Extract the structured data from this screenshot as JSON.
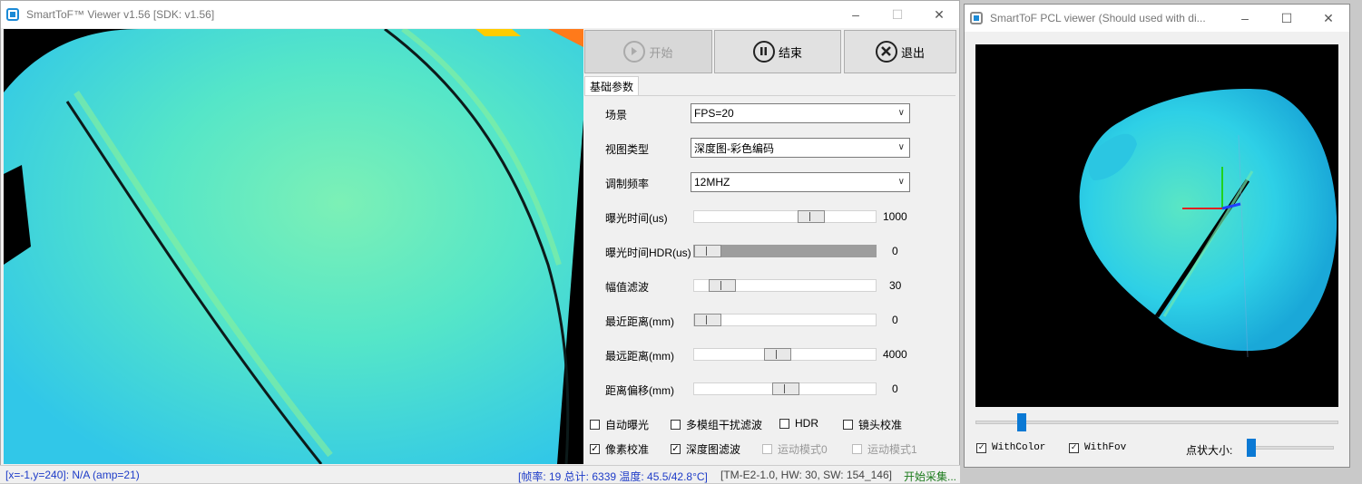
{
  "viewer": {
    "title": "SmartToF™ Viewer v1.56 [SDK: v1.56]",
    "buttons": {
      "start": "开始",
      "stop": "结束",
      "exit": "退出"
    },
    "tab": "基础参数",
    "params": {
      "scene_label": "场景",
      "scene_value": "FPS=20",
      "view_label": "视图类型",
      "view_value": "深度图-彩色编码",
      "freq_label": "调制频率",
      "freq_value": "12MHZ",
      "exposure_label": "曝光时间(us)",
      "exposure_value": "1000",
      "hdr_label": "曝光时间HDR(us)",
      "hdr_value": "0",
      "amp_label": "幅值滤波",
      "amp_value": "30",
      "near_label": "最近距离(mm)",
      "near_value": "0",
      "far_label": "最远距离(mm)",
      "far_value": "4000",
      "offset_label": "距离偏移(mm)",
      "offset_value": "0"
    },
    "checks": {
      "auto_exposure": "自动曝光",
      "multi_filter": "多模组干扰滤波",
      "hdr": "HDR",
      "lens_calib": "镜头校准",
      "pixel_calib": "像素校准",
      "depth_filter": "深度图滤波",
      "motion0": "运动模式0",
      "motion1": "运动模式1"
    },
    "status": {
      "cursor": "[x=-1,y=240]: N/A (amp=21)",
      "frame": "[帧率: 19 总计: 6339 温度: 45.5/42.8°C]",
      "hw": "[TM-E2-1.0, HW: 30, SW: 154_146]",
      "state": "开始采集..."
    }
  },
  "pcl": {
    "title": "SmartToF PCL viewer (Should used with di...",
    "with_color": "WithColor",
    "with_fov": "WithFov",
    "point_size_label": "点状大小:"
  },
  "colors": {
    "depth_main": "#3fd8e0",
    "pcl_cyan": "#29c9e6",
    "status_blue": "#1e3cc8",
    "status_green": "#1a7a1a"
  }
}
